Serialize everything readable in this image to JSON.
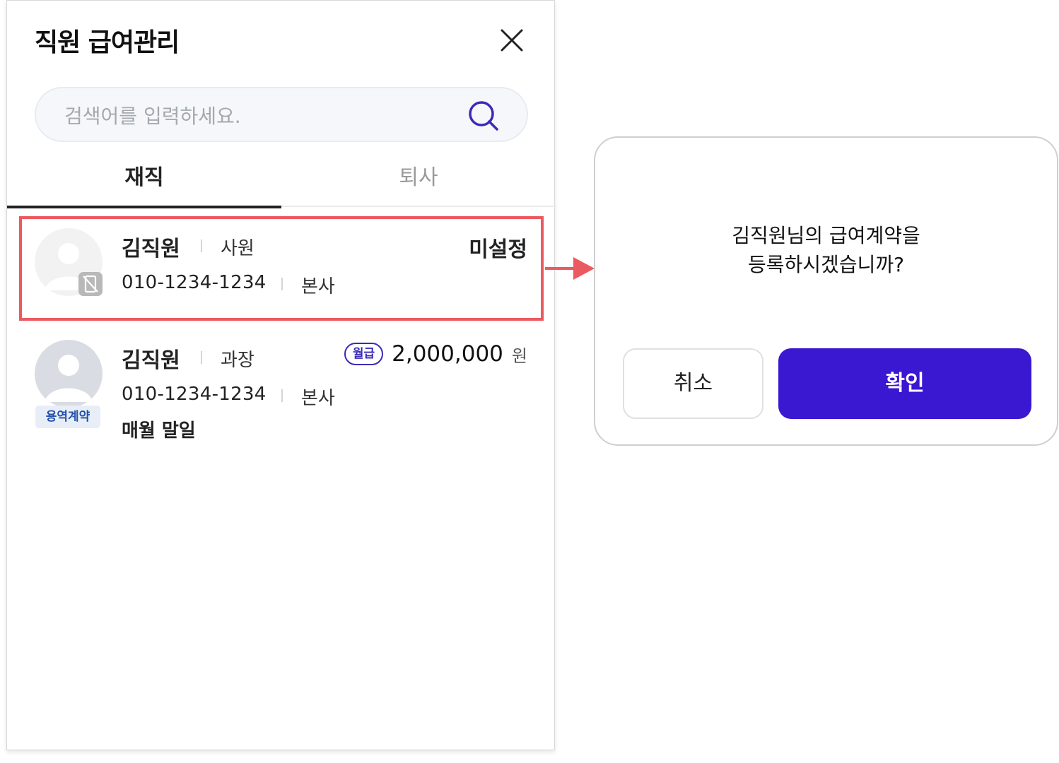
{
  "panel": {
    "title": "직원 급여관리",
    "search": {
      "placeholder": "검색어를 입력하세요."
    },
    "tabs": [
      {
        "label": "재직",
        "active": true
      },
      {
        "label": "퇴사",
        "active": false
      }
    ],
    "employees": [
      {
        "name": "김직원",
        "position": "사원",
        "phone": "010-1234-1234",
        "branch": "본사",
        "status": "미설정",
        "avatar_overlay_icon": "no-phone-icon"
      },
      {
        "name": "김직원",
        "position": "과장",
        "phone": "010-1234-1234",
        "branch": "본사",
        "contract_badge": "용역계약",
        "pay_type": "월급",
        "amount": "2,000,000",
        "currency": "원",
        "pay_day": "매월 말일"
      }
    ]
  },
  "dialog": {
    "message_line1": "김직원님의 급여계약을",
    "message_line2": "등록하시겠습니까?",
    "cancel_label": "취소",
    "confirm_label": "확인"
  },
  "colors": {
    "highlight": "#ea5a5f",
    "primary": "#3a17d1",
    "pill": "#3a2ab8"
  }
}
